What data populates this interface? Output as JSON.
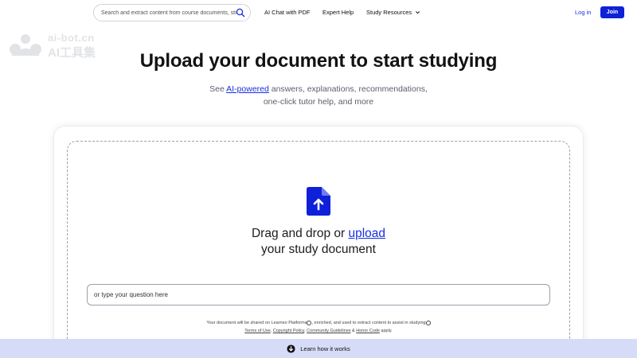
{
  "header": {
    "search_placeholder": "Search and extract content from course documents, study resources, and more",
    "nav": {
      "ai_chat": "AI Chat with PDF",
      "expert_help": "Expert Help",
      "study_resources": "Study Resources"
    },
    "login": "Log in",
    "join": "Join"
  },
  "watermark": {
    "top": "ai-bot.cn",
    "bottom": "AI工具集"
  },
  "hero": {
    "title": "Upload your document to start studying",
    "sub_prefix": "See ",
    "sub_link": "AI-powered",
    "sub_rest": " answers, explanations, recommendations,",
    "sub_line2": "one-click tutor help, and more"
  },
  "upload": {
    "line1_prefix": "Drag and drop or ",
    "line1_link": "upload",
    "line2": "your study document",
    "question_placeholder": "or type your question here"
  },
  "disclaimer": {
    "part1": "Your document will be shared on Learneo Platforms",
    "part2": ", enriched, and used to extract content to assist in studying",
    "terms": "Terms of Use",
    "sep1": ", ",
    "copyright": "Copyright Policy",
    "sep2": ", ",
    "guidelines": "Community Guidelines",
    "amp": " & ",
    "honor": "Honor Code",
    "tail": " apply."
  },
  "bottom_bar": {
    "label": "Learn how it works"
  },
  "colors": {
    "accent": "#0f21d8",
    "link": "#1a2ee0",
    "bottom_bar": "#d6dcf8"
  }
}
